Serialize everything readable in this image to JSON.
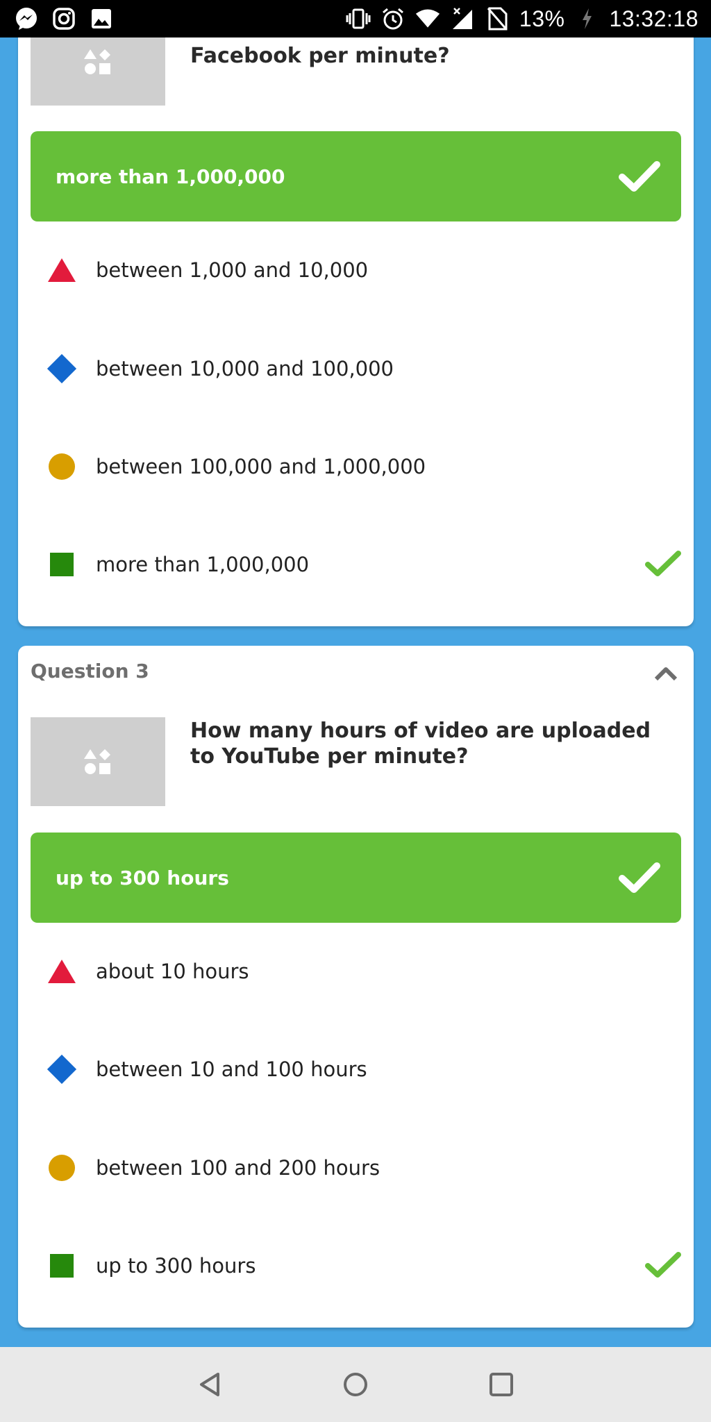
{
  "status_bar": {
    "left_icons": [
      "messenger-icon",
      "instagram-icon",
      "gallery-icon"
    ],
    "right_icons": [
      "vibrate-icon",
      "alarm-icon",
      "wifi-icon",
      "mobile-data-off-icon",
      "no-sim-icon",
      "charging-icon"
    ],
    "battery": "13%",
    "time": "13:32:18"
  },
  "question2": {
    "text": "How many messages are posted on Facebook per minute?",
    "visible_text": "Facebook per minute?",
    "correct_answer": "more than 1,000,000",
    "options": [
      {
        "shape": "triangle",
        "label": "between 1,000 and 10,000",
        "correct": false
      },
      {
        "shape": "diamond",
        "label": "between 10,000 and 100,000",
        "correct": false
      },
      {
        "shape": "circle",
        "label": "between 100,000 and 1,000,000",
        "correct": false
      },
      {
        "shape": "square",
        "label": "more than 1,000,000",
        "correct": true
      }
    ]
  },
  "question3": {
    "label": "Question 3",
    "text": "How many hours of video are uploaded to YouTube per minute?",
    "correct_answer": "up to 300 hours",
    "options": [
      {
        "shape": "triangle",
        "label": "about 10 hours",
        "correct": false
      },
      {
        "shape": "diamond",
        "label": "between 10 and 100 hours",
        "correct": false
      },
      {
        "shape": "circle",
        "label": "between 100 and 200 hours",
        "correct": false
      },
      {
        "shape": "square",
        "label": "up to 300 hours",
        "correct": true
      }
    ]
  },
  "colors": {
    "background": "#47a5e3",
    "correct_green": "#66bf39",
    "triangle_red": "#e21b3c",
    "diamond_blue": "#1368ce",
    "circle_yellow": "#d89e00",
    "square_green": "#26890c"
  },
  "nav_bar": {
    "buttons": [
      "back-icon",
      "home-icon",
      "recents-icon"
    ]
  }
}
